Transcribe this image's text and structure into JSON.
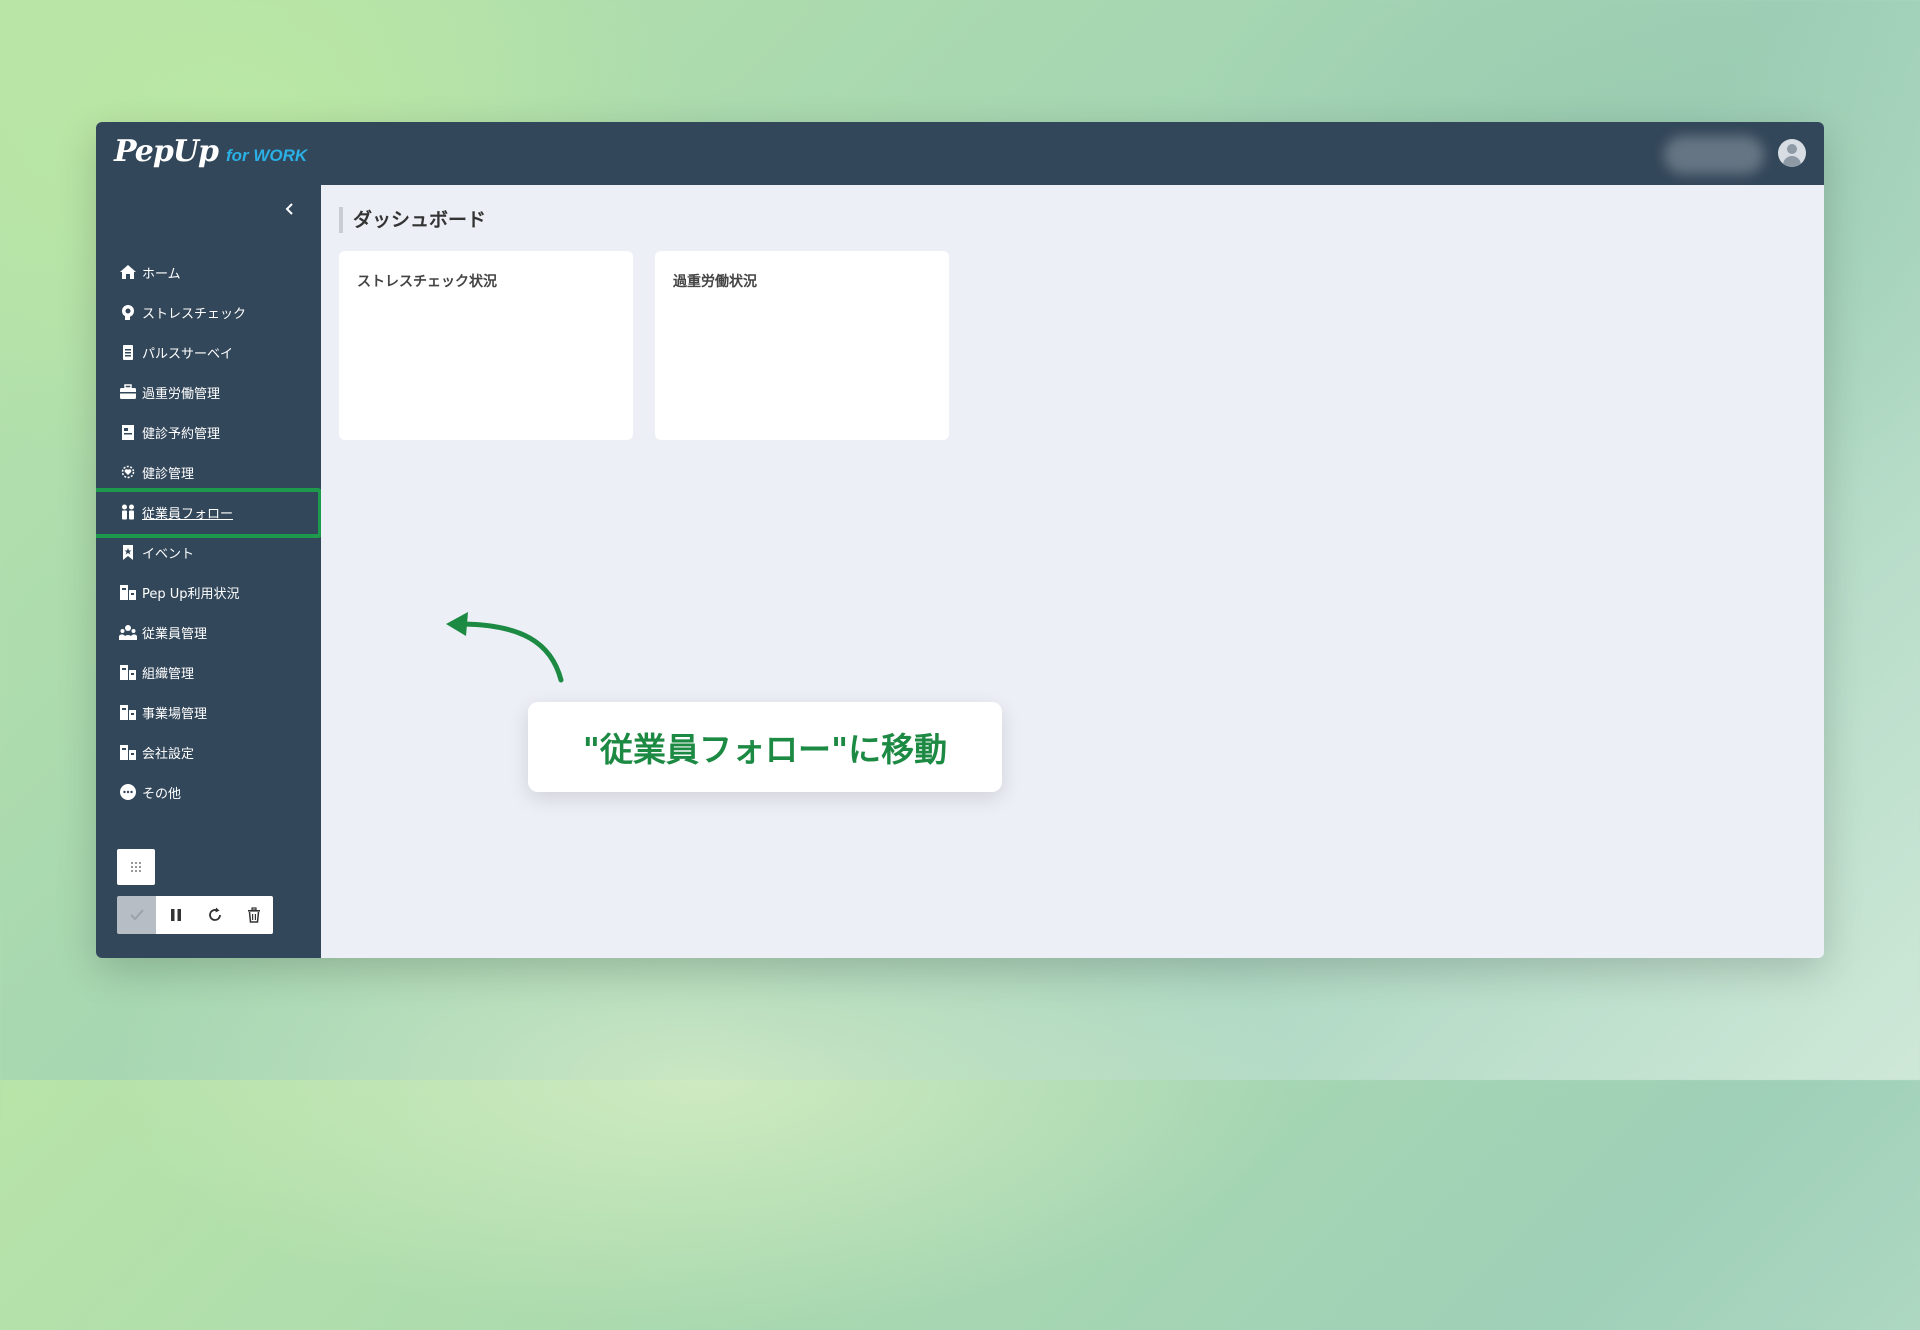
{
  "app": {
    "logo_main": "PepUp",
    "logo_sub": "for WORK"
  },
  "sidebar": {
    "collapse_icon": "chevron-left-icon",
    "items": [
      {
        "label": "ホーム",
        "icon": "home-icon"
      },
      {
        "label": "ストレスチェック",
        "icon": "brain-icon"
      },
      {
        "label": "パルスサーベイ",
        "icon": "clipboard-icon"
      },
      {
        "label": "過重労働管理",
        "icon": "briefcase-icon"
      },
      {
        "label": "健診予約管理",
        "icon": "calendar-icon"
      },
      {
        "label": "健診管理",
        "icon": "heart-icon"
      },
      {
        "label": "従業員フォロー",
        "icon": "people-icon",
        "active": true
      },
      {
        "label": "イベント",
        "icon": "bookmark-star-icon"
      },
      {
        "label": "Pep Up利用状況",
        "icon": "building-icon"
      },
      {
        "label": "従業員管理",
        "icon": "group-icon"
      },
      {
        "label": "組織管理",
        "icon": "building-icon"
      },
      {
        "label": "事業場管理",
        "icon": "building-icon"
      },
      {
        "label": "会社設定",
        "icon": "building-icon"
      },
      {
        "label": "その他",
        "icon": "more-icon"
      }
    ]
  },
  "main": {
    "page_title": "ダッシュボード",
    "cards": [
      {
        "title": "ストレスチェック状況"
      },
      {
        "title": "過重労働状況"
      }
    ]
  },
  "callout": {
    "text": "\"従業員フォロー\"に移動"
  },
  "colors": {
    "sidebar": "#33475a",
    "highlight": "#1d9a4b",
    "callout_text": "#1d8a44",
    "logo_sub": "#2ab0e6"
  }
}
